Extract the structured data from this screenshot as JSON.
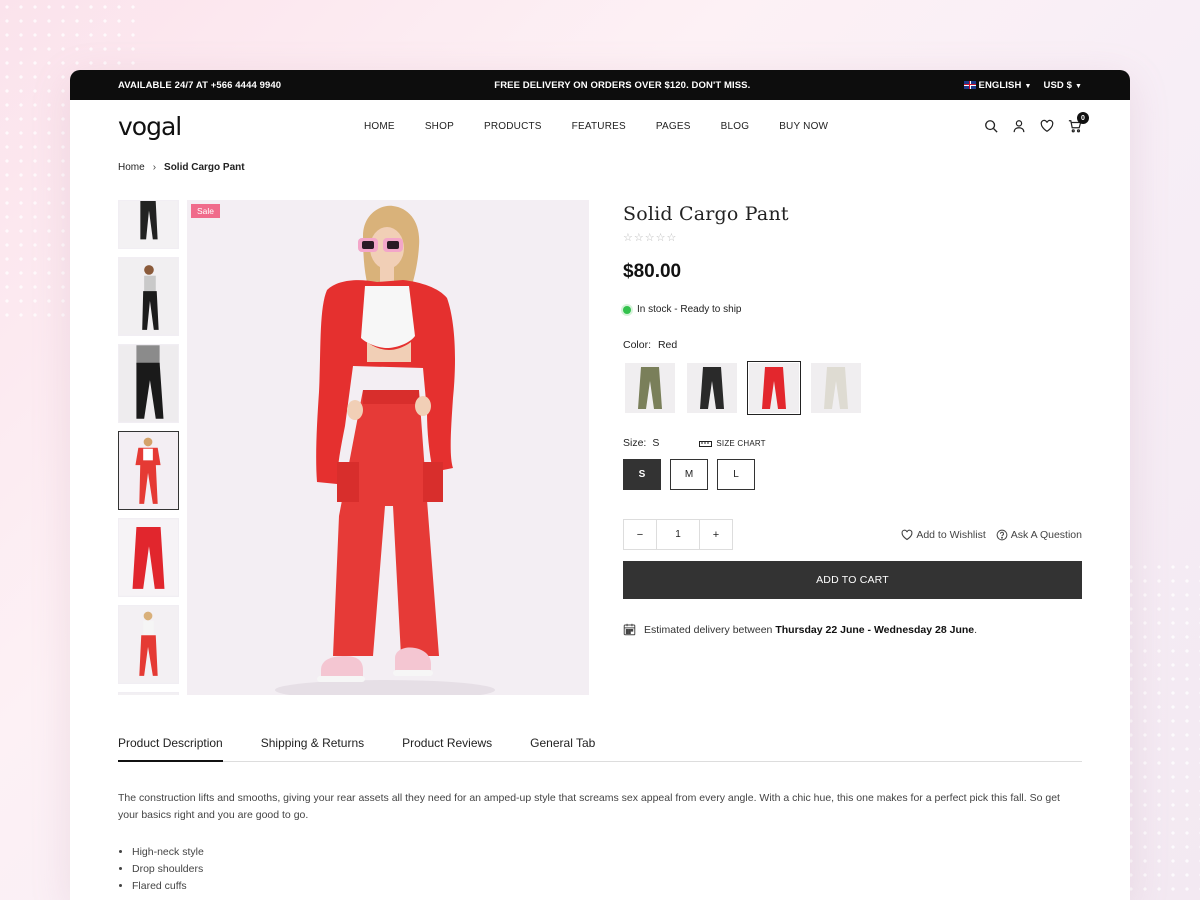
{
  "topbar": {
    "phone": "AVAILABLE 24/7 AT +566 4444 9940",
    "promo": "FREE DELIVERY ON ORDERS OVER $120. DON'T MISS.",
    "language": "ENGLISH",
    "currency": "USD $"
  },
  "header": {
    "logo": "vogal",
    "nav": [
      "HOME",
      "SHOP",
      "PRODUCTS",
      "FEATURES",
      "PAGES",
      "BLOG",
      "BUY NOW"
    ],
    "cart_count": "0"
  },
  "breadcrumb": {
    "home": "Home",
    "current": "Solid Cargo Pant"
  },
  "gallery": {
    "sale_badge": "Sale",
    "active_thumb": 3
  },
  "product": {
    "title": "Solid Cargo Pant",
    "stars": "☆☆☆☆☆",
    "price": "$80.00",
    "stock": "In stock - Ready to ship",
    "color_label": "Color:",
    "color_value": "Red",
    "colors": [
      "#7a7f5a",
      "#2a2a2a",
      "#e3272d",
      "#e4e2da"
    ],
    "active_color": 2,
    "size_label": "Size:",
    "size_value": "S",
    "size_chart": "SIZE CHART",
    "sizes": [
      "S",
      "M",
      "L"
    ],
    "active_size": 0,
    "qty_minus": "−",
    "qty_value": "1",
    "qty_plus": "+",
    "wishlist": "Add to Wishlist",
    "ask": "Ask A Question",
    "add_to_cart": "ADD TO CART",
    "delivery_prefix": "Estimated delivery between",
    "delivery_start": "Thursday 22 June",
    "delivery_sep": " - ",
    "delivery_end": "Wednesday 28 June",
    "delivery_suffix": "."
  },
  "tabs": [
    "Product Description",
    "Shipping & Returns",
    "Product Reviews",
    "General Tab"
  ],
  "description": {
    "text": "The construction lifts and smooths, giving your rear assets all they need for an amped-up style that screams sex appeal from every angle. With a chic hue, this one makes for a perfect pick this fall. So get your basics right and you are good to go.",
    "bullets": [
      "High-neck style",
      "Drop shoulders",
      "Flared cuffs"
    ]
  },
  "colors": {
    "topbar": "#0d0d0d",
    "sale": "#f06b8b",
    "stock_dot": "#33c24d",
    "button": "#333333"
  }
}
